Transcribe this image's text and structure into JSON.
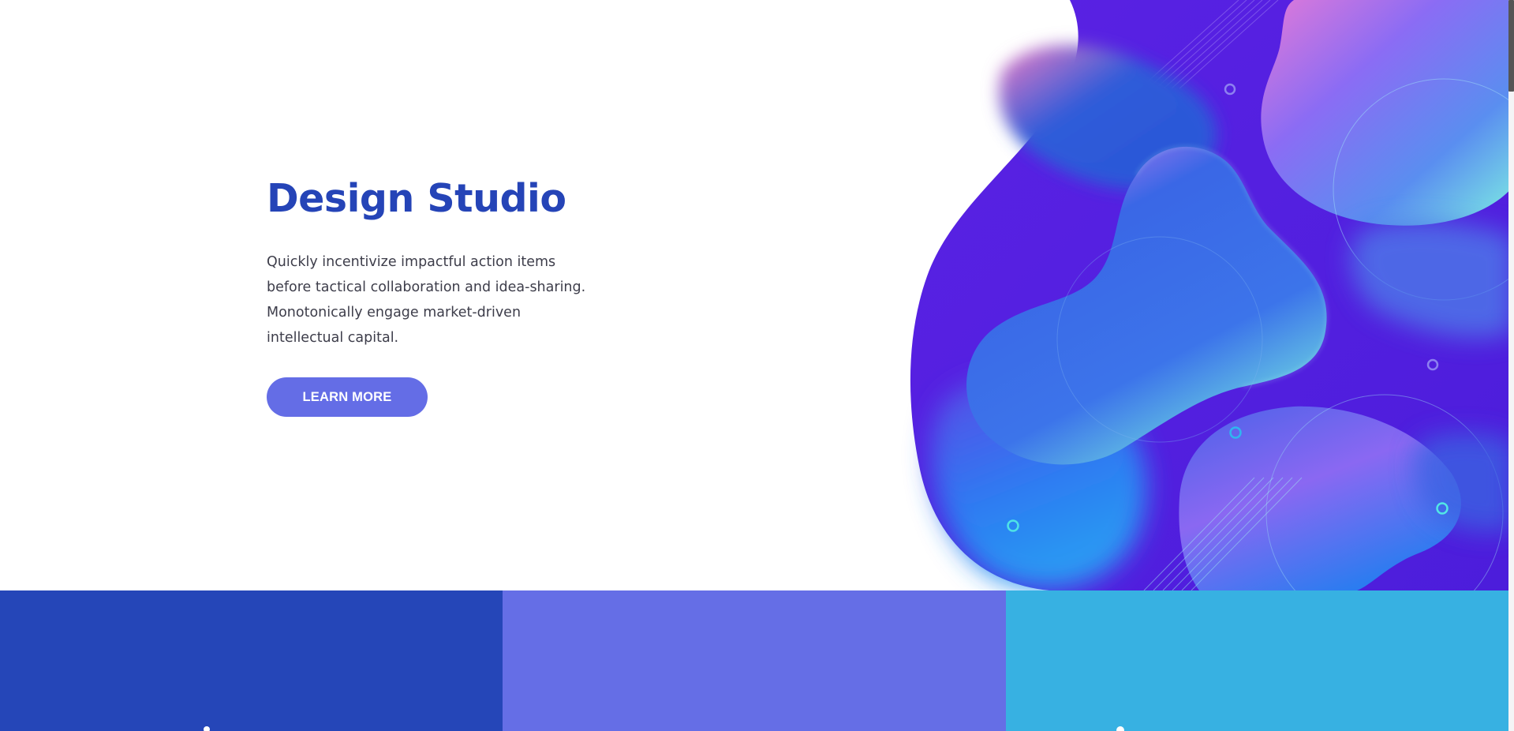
{
  "hero": {
    "title": "Design Studio",
    "description": "Quickly incentivize impactful action items before tactical collaboration and idea-sharing. Monotonically engage market-driven intellectual capital.",
    "cta_label": "LEARN MORE"
  },
  "colors": {
    "title": "#2544b7",
    "button": "#646de6",
    "art_background": "#5120e0",
    "panel_1": "#2546b8",
    "panel_2": "#656ee6",
    "panel_3": "#37b1e2"
  },
  "illustration": {
    "icon": "gradient-blob-illustration"
  },
  "features": {
    "panels": [
      {
        "color": "#2546b8",
        "icon": "feature-icon"
      },
      {
        "color": "#656ee6",
        "icon": ""
      },
      {
        "color": "#37b1e2",
        "icon": "feature-icon"
      }
    ]
  }
}
